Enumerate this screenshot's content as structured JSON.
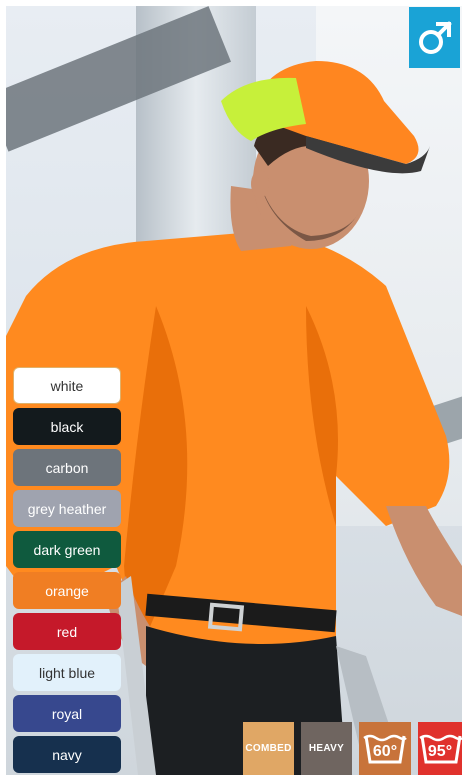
{
  "gender": {
    "icon": "male-symbol-icon",
    "color": "#1aa3d6"
  },
  "colors": [
    {
      "label": "white",
      "bg": "#ffffff",
      "fg": "#333333"
    },
    {
      "label": "black",
      "bg": "#131a1d",
      "fg": "#ffffff"
    },
    {
      "label": "carbon",
      "bg": "#6d747b",
      "fg": "#ffffff"
    },
    {
      "label": "grey heather",
      "bg": "#9fa3af",
      "fg": "#ffffff"
    },
    {
      "label": "dark green",
      "bg": "#0f5a3e",
      "fg": "#ffffff"
    },
    {
      "label": "orange",
      "bg": "#f07e23",
      "fg": "#ffffff"
    },
    {
      "label": "red",
      "bg": "#c5192a",
      "fg": "#ffffff"
    },
    {
      "label": "light blue",
      "bg": "#e2f1fb",
      "fg": "#333333"
    },
    {
      "label": "royal",
      "bg": "#37488e",
      "fg": "#ffffff"
    },
    {
      "label": "navy",
      "bg": "#16304e",
      "fg": "#ffffff"
    }
  ],
  "badges": {
    "combed": {
      "label": "COMBED",
      "color": "#e0a765"
    },
    "heavy": {
      "label": "HEAVY",
      "color": "#6f6560"
    },
    "wash60": {
      "label": "60°",
      "color": "#c8733a",
      "icon": "wash-60-icon"
    },
    "wash95": {
      "label": "95°",
      "color": "#e0312c",
      "icon": "wash-95-icon"
    }
  }
}
